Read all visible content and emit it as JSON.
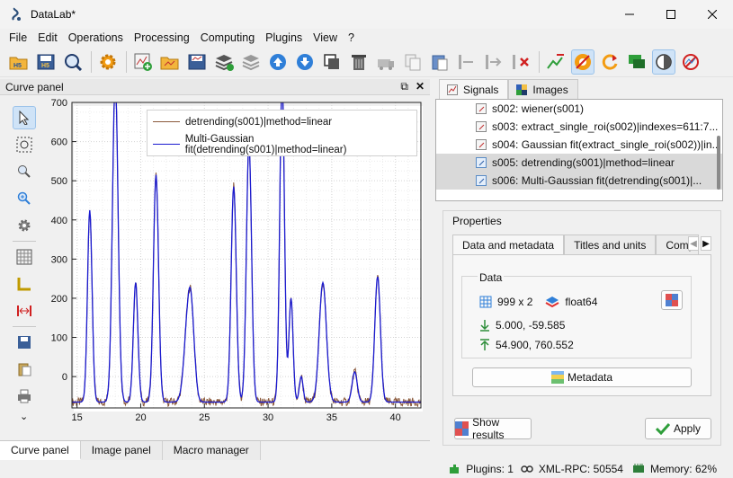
{
  "window": {
    "title": "DataLab*"
  },
  "menu": [
    "File",
    "Edit",
    "Operations",
    "Processing",
    "Computing",
    "Plugins",
    "View",
    "?"
  ],
  "toolbar": {
    "icons": [
      "open-h5-icon",
      "save-h5-icon",
      "browse-h5-icon",
      "settings-icon",
      "new-signal-icon",
      "open-signal-icon",
      "save-signal-icon",
      "stack-icon",
      "stack-grey-icon",
      "move-up-icon",
      "move-down-icon",
      "duplicate-icon",
      "delete-icon",
      "delete-results-icon",
      "copy-icon",
      "paste-icon",
      "remove-roi-icon",
      "add-roi-icon",
      "remove-all-icon",
      "delete-metadata-icon",
      "plugin-orange-icon",
      "refresh-icon",
      "speech-icon",
      "contrast-icon",
      "no-signal-icon"
    ]
  },
  "curve_panel": {
    "title": "Curve panel",
    "float_icon": "⧉",
    "close_icon": "✕",
    "tools": [
      "select-icon",
      "zoom-rect-icon",
      "zoom-out-icon",
      "zoom-in-icon",
      "settings-gear-icon",
      "grid-icon",
      "axes-icon",
      "distance-icon",
      "save-icon",
      "copy-icon",
      "print-icon",
      "more-icon"
    ],
    "legend": [
      {
        "label": "detrending(s001)|method=linear",
        "color": "#8b5a3c"
      },
      {
        "label": "Multi-Gaussian fit(detrending(s001)|method=linear)",
        "color": "#1a1ad0"
      }
    ],
    "more_symbol": "⌄"
  },
  "chart_data": {
    "type": "line",
    "xlim": [
      14.6,
      42
    ],
    "ylim": [
      -80,
      700
    ],
    "xticks": [
      15,
      20,
      25,
      30,
      35,
      40
    ],
    "yticks": [
      0,
      100,
      200,
      300,
      400,
      500,
      600,
      700
    ],
    "grid": true,
    "legend_position": "top-right",
    "baseline": -65,
    "peaks": [
      {
        "x": 16.0,
        "height": 425,
        "width": 0.18
      },
      {
        "x": 18.0,
        "height": 760,
        "width": 0.22
      },
      {
        "x": 19.6,
        "height": 240,
        "width": 0.18
      },
      {
        "x": 21.2,
        "height": 515,
        "width": 0.2
      },
      {
        "x": 23.7,
        "height": 125,
        "width": 0.3
      },
      {
        "x": 24.0,
        "height": 85,
        "width": 0.25
      },
      {
        "x": 27.3,
        "height": 485,
        "width": 0.2
      },
      {
        "x": 28.5,
        "height": 600,
        "width": 0.2
      },
      {
        "x": 31.1,
        "height": 760,
        "width": 0.18
      },
      {
        "x": 31.8,
        "height": 200,
        "width": 0.16
      },
      {
        "x": 32.6,
        "height": 0,
        "width": 0.15
      },
      {
        "x": 34.3,
        "height": 240,
        "width": 0.28
      },
      {
        "x": 36.8,
        "height": 12,
        "width": 0.2
      },
      {
        "x": 38.6,
        "height": 255,
        "width": 0.22
      }
    ],
    "series": [
      {
        "name": "detrending(s001)|method=linear",
        "color": "#8b5a3c"
      },
      {
        "name": "Multi-Gaussian fit(detrending(s001)|method=linear)",
        "color": "#1a1ad0"
      }
    ]
  },
  "bottom_tabs": [
    "Curve panel",
    "Image panel",
    "Macro manager"
  ],
  "right_tabs": [
    {
      "label": "Signals",
      "icon": "signals-icon"
    },
    {
      "label": "Images",
      "icon": "images-icon"
    }
  ],
  "signals": [
    {
      "label": "s002: wiener(s001)",
      "selected": false
    },
    {
      "label": "s003: extract_single_roi(s002)|indexes=611:7...",
      "selected": false
    },
    {
      "label": "s004: Gaussian fit(extract_single_roi(s002))|in...",
      "selected": false
    },
    {
      "label": "s005: detrending(s001)|method=linear",
      "selected": true
    },
    {
      "label": "s006: Multi-Gaussian fit(detrending(s001)|...",
      "selected": true
    }
  ],
  "properties": {
    "title": "Properties",
    "tabs": [
      "Data and metadata",
      "Titles and units",
      "Compu"
    ],
    "tab_left_arrow": "◀",
    "tab_right_arrow": "▶",
    "data_group_title": "Data",
    "shape": "999 x 2",
    "dtype": "float64",
    "min": "5.000, -59.585",
    "max": "54.900, 760.552",
    "metadata_button": "Metadata",
    "show_results_button": "Show results",
    "apply_button": "Apply"
  },
  "status": {
    "plugins": "Plugins: 1",
    "xmlrpc": "XML-RPC: 50554",
    "memory": "Memory: 62%"
  }
}
